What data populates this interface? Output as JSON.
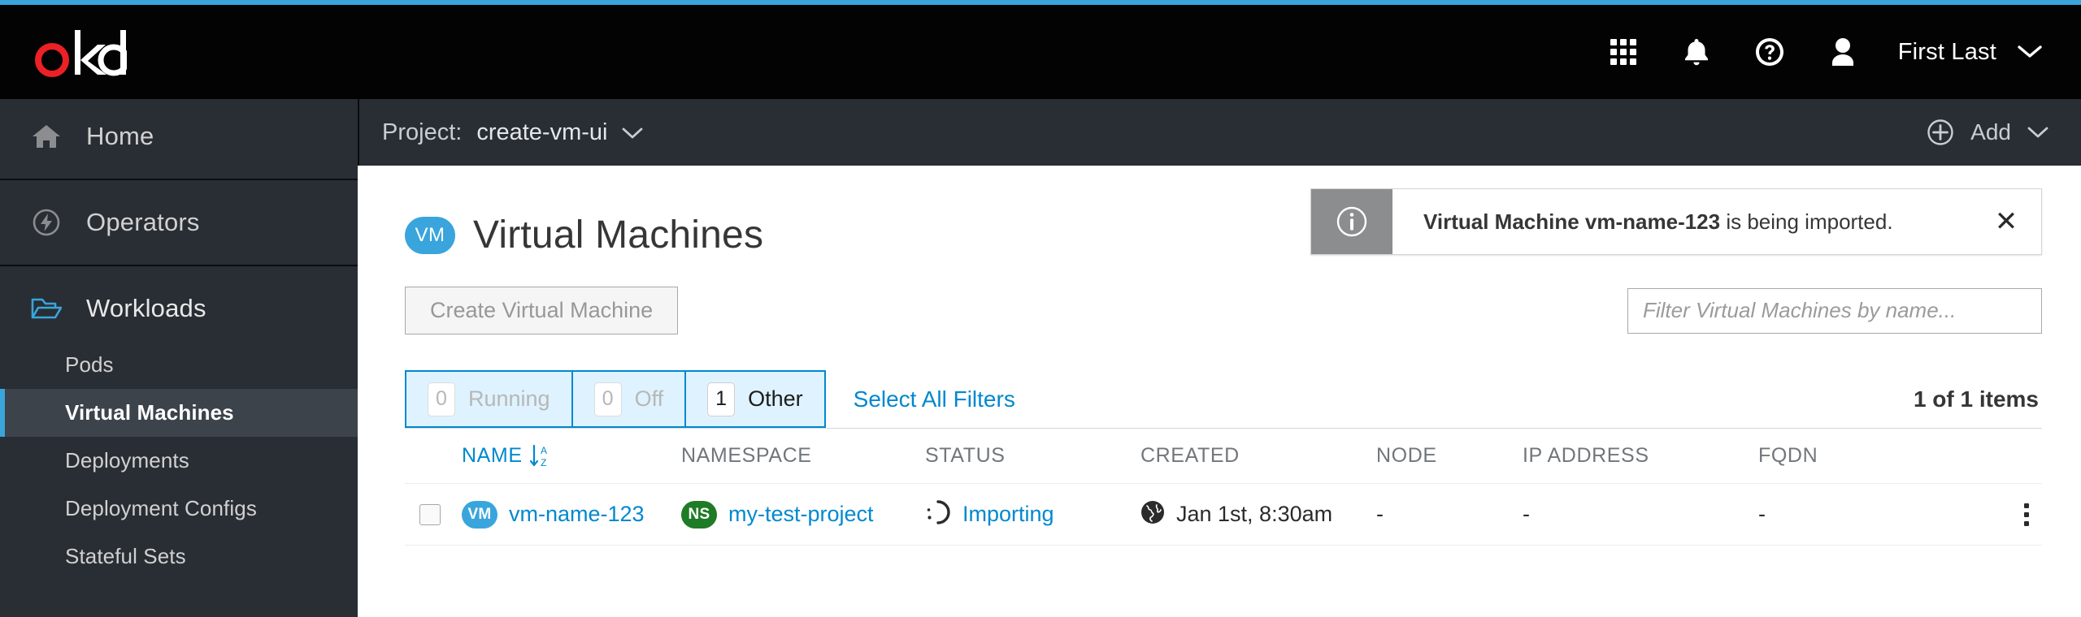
{
  "brand": {
    "name": "okd",
    "accent_color": "#39a5dc",
    "logo_o_color": "#ed2024"
  },
  "masthead": {
    "icons": [
      {
        "name": "application-launcher-icon",
        "glyph": "grid"
      },
      {
        "name": "notification-bell-icon",
        "glyph": "bell"
      },
      {
        "name": "help-icon",
        "glyph": "question-circle"
      },
      {
        "name": "user-avatar-icon",
        "glyph": "user"
      }
    ],
    "user_name": "First Last"
  },
  "project_bar": {
    "project_label": "Project:",
    "project_value": "create-vm-ui",
    "add_label": "Add"
  },
  "sidebar": {
    "groups": [
      {
        "label": "Home",
        "icon": "home-icon",
        "expanded": false,
        "items": []
      },
      {
        "label": "Operators",
        "icon": "operators-icon",
        "expanded": false,
        "items": []
      },
      {
        "label": "Workloads",
        "icon": "folder-open-icon",
        "expanded": true,
        "items": [
          {
            "label": "Pods",
            "active": false
          },
          {
            "label": "Virtual Machines",
            "active": true
          },
          {
            "label": "Deployments",
            "active": false
          },
          {
            "label": "Deployment Configs",
            "active": false
          },
          {
            "label": "Stateful Sets",
            "active": false
          }
        ]
      }
    ]
  },
  "alert": {
    "severity": "info",
    "text_bold": "Virtual Machine vm-name-123",
    "text_rest": " is being imported.",
    "close_label": "✕"
  },
  "page": {
    "badge": "VM",
    "title": "Virtual Machines"
  },
  "toolbar": {
    "create_label": "Create Virtual Machine",
    "filter_placeholder": "Filter Virtual Machines by name..."
  },
  "filters": {
    "segments": [
      {
        "count": "0",
        "label": "Running",
        "muted": true
      },
      {
        "count": "0",
        "label": "Off",
        "muted": true
      },
      {
        "count": "1",
        "label": "Other",
        "muted": false
      }
    ],
    "select_all_label": "Select All Filters",
    "items_count": "1 of 1 items"
  },
  "table": {
    "columns": [
      {
        "label": "NAME",
        "sorted": true,
        "sort_dir": "asc"
      },
      {
        "label": "NAMESPACE",
        "sorted": false
      },
      {
        "label": "STATUS",
        "sorted": false
      },
      {
        "label": "CREATED",
        "sorted": false
      },
      {
        "label": "NODE",
        "sorted": false
      },
      {
        "label": "IP ADDRESS",
        "sorted": false
      },
      {
        "label": "FQDN",
        "sorted": false
      }
    ],
    "rows": [
      {
        "selected": false,
        "name_badge": "VM",
        "name": "vm-name-123",
        "namespace_badge": "NS",
        "namespace": "my-test-project",
        "status": "Importing",
        "status_icon": "spinner-icon",
        "created": "Jan 1st, 8:30am",
        "created_icon": "globe-icon",
        "node": "-",
        "ip_address": "-",
        "fqdn": "-"
      }
    ]
  },
  "colors": {
    "link": "#0088ce",
    "vm_badge": "#39a5dc",
    "ns_badge": "#1e7b26",
    "segment_bg": "#def3ff",
    "segment_border": "#0088ce",
    "sidebar_bg": "#292e34",
    "sidebar_active_bg": "#3c434b",
    "masthead_bg": "#030303",
    "alert_icon_bg": "#8b8d8f"
  }
}
